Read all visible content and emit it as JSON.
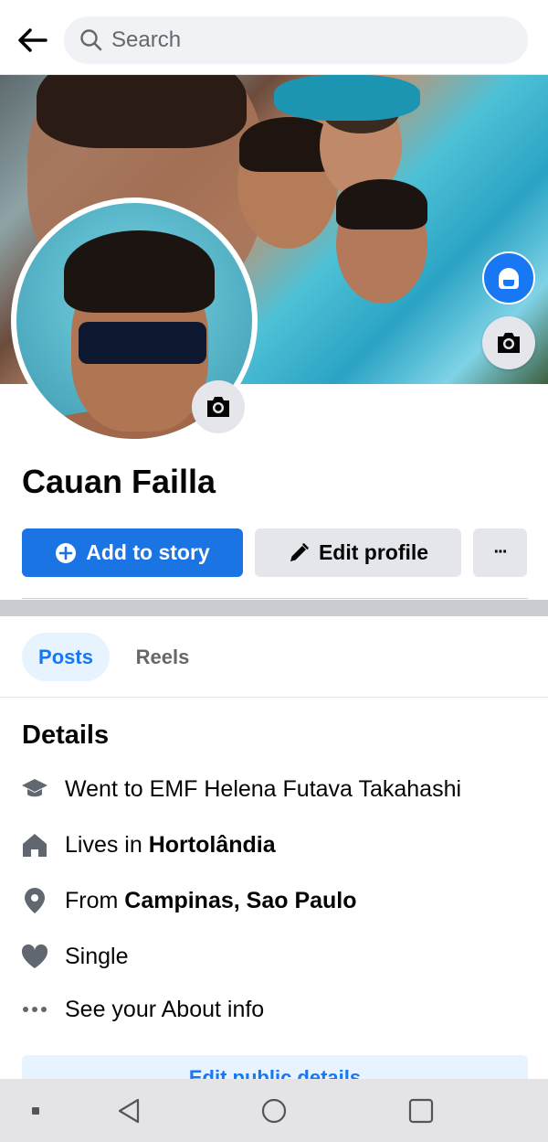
{
  "search": {
    "placeholder": "Search"
  },
  "profile": {
    "name": "Cauan Failla"
  },
  "actions": {
    "add_story": "Add to story",
    "edit_profile": "Edit profile",
    "more": "···"
  },
  "tabs": [
    {
      "label": "Posts",
      "selected": true
    },
    {
      "label": "Reels",
      "selected": false
    }
  ],
  "details": {
    "title": "Details",
    "items": [
      {
        "icon": "graduation-cap-icon",
        "prefix": "Went to EMF Helena Futava Takahashi",
        "bold": ""
      },
      {
        "icon": "home-icon",
        "prefix": "Lives in ",
        "bold": "Hortolândia"
      },
      {
        "icon": "location-pin-icon",
        "prefix": "From ",
        "bold": "Campinas, Sao Paulo"
      },
      {
        "icon": "heart-icon",
        "prefix": "Single",
        "bold": ""
      },
      {
        "icon": "more-dots-icon",
        "prefix": "See your About info",
        "bold": ""
      }
    ],
    "edit_public": "Edit public details"
  },
  "colors": {
    "accent": "#1877f2",
    "button_primary": "#1b74e4",
    "button_secondary": "#e4e6eb",
    "text_secondary": "#65676b"
  }
}
